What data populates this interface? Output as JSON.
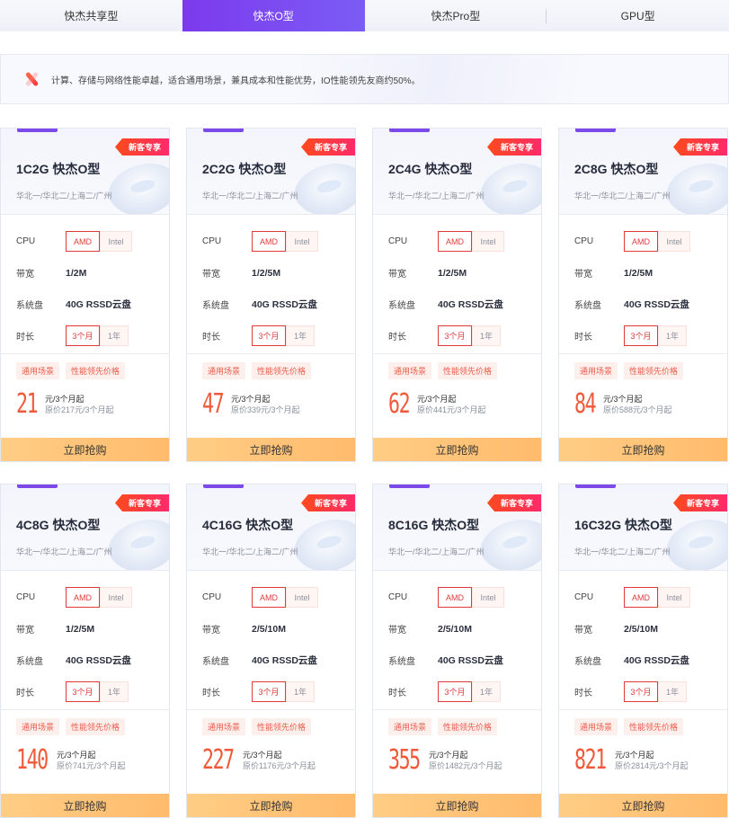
{
  "tabs": [
    {
      "label": "快杰共享型",
      "active": false
    },
    {
      "label": "快杰O型",
      "active": true
    },
    {
      "label": "快杰Pro型",
      "active": false
    },
    {
      "label": "GPU型",
      "active": false
    }
  ],
  "intro": {
    "icon": "sparkle-icon",
    "text": "计算、存储与网络性能卓越，适合通用场景，兼具成本和性能优势，IO性能领先友商约50%。"
  },
  "labels": {
    "badge": "新客专享",
    "cpu": "CPU",
    "bandwidth": "带宽",
    "disk": "系统盘",
    "duration": "时长",
    "cpu_options": [
      "AMD",
      "Intel"
    ],
    "cpu_selected": "AMD",
    "duration_options": [
      "3个月",
      "1年"
    ],
    "duration_selected": "3个月",
    "tags": [
      "通用场景",
      "性能领先价格"
    ],
    "price_unit": "元/3个月起",
    "buy": "立即抢购"
  },
  "colors": {
    "accent": "#7c3aed",
    "badge": "#ff4a1c",
    "price": "#f05a3a",
    "selected_border": "#e03a3a",
    "buy_button": "#ffc478"
  },
  "cards": [
    {
      "title": "1C2G 快杰O型",
      "regions": "华北一/华北二/上海二/广州",
      "bandwidth": "1/2M",
      "disk": "40G RSSD云盘",
      "price": "21",
      "original": "原价217元/3个月起"
    },
    {
      "title": "2C2G 快杰O型",
      "regions": "华北一/华北二/上海二/广州",
      "bandwidth": "1/2/5M",
      "disk": "40G RSSD云盘",
      "price": "47",
      "original": "原价339元/3个月起"
    },
    {
      "title": "2C4G 快杰O型",
      "regions": "华北一/华北二/上海二/广州",
      "bandwidth": "1/2/5M",
      "disk": "40G RSSD云盘",
      "price": "62",
      "original": "原价441元/3个月起"
    },
    {
      "title": "2C8G 快杰O型",
      "regions": "华北一/华北二/上海二/广州",
      "bandwidth": "1/2/5M",
      "disk": "40G RSSD云盘",
      "price": "84",
      "original": "原价588元/3个月起"
    },
    {
      "title": "4C8G 快杰O型",
      "regions": "华北一/华北二/上海二/广州",
      "bandwidth": "1/2/5M",
      "disk": "40G RSSD云盘",
      "price": "140",
      "original": "原价741元/3个月起"
    },
    {
      "title": "4C16G 快杰O型",
      "regions": "华北一/华北二/上海二/广州",
      "bandwidth": "2/5/10M",
      "disk": "40G RSSD云盘",
      "price": "227",
      "original": "原价1176元/3个月起"
    },
    {
      "title": "8C16G 快杰O型",
      "regions": "华北一/华北二/上海二/广州",
      "bandwidth": "2/5/10M",
      "disk": "40G RSSD云盘",
      "price": "355",
      "original": "原价1482元/3个月起"
    },
    {
      "title": "16C32G 快杰O型",
      "regions": "华北一/华北二/上海二/广州",
      "bandwidth": "2/5/10M",
      "disk": "40G RSSD云盘",
      "price": "821",
      "original": "原价2814元/3个月起"
    }
  ]
}
